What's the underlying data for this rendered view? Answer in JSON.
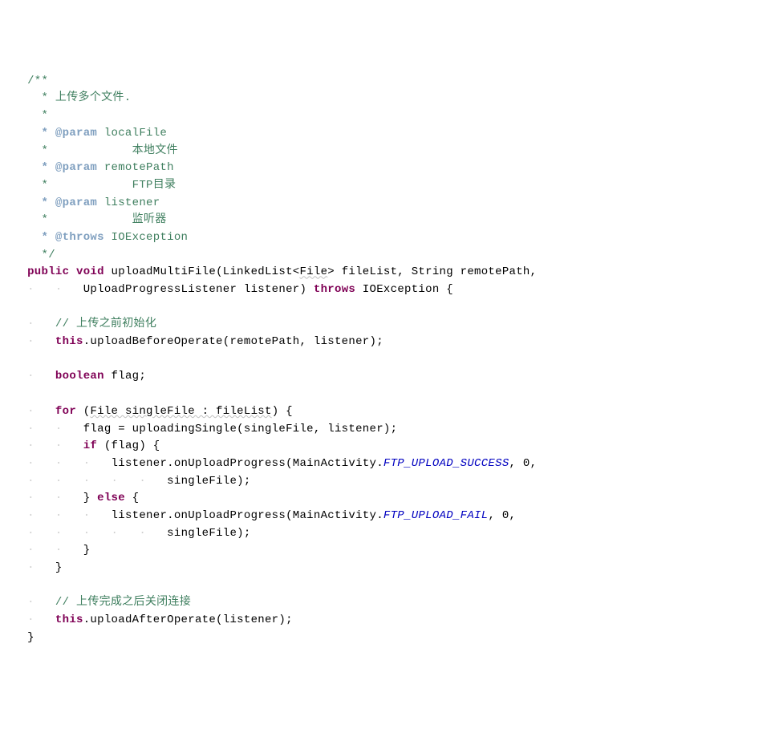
{
  "code": {
    "doc_open": "/**",
    "doc_line1": " * 上传多个文件.",
    "doc_star": " *",
    "doc_param1_tag": " * @param",
    "doc_param1_name": " localFile",
    "doc_param1_desc": " *            本地文件",
    "doc_param2_tag": " * @param",
    "doc_param2_name": " remotePath",
    "doc_param2_desc": " *            FTP目录",
    "doc_param3_tag": " * @param",
    "doc_param3_name": " listener",
    "doc_param3_desc": " *            监听器",
    "doc_throws_tag": " * @throws",
    "doc_throws_name": " IOException",
    "doc_close": " */",
    "kw_public": "public",
    "kw_void": "void",
    "method_name": " uploadMultiFile(LinkedList<",
    "type_file": "File",
    "method_sig_mid": "> fileList, String remotePath,",
    "indent_dot1": "·",
    "indent_sp": "   ",
    "method_sig2": "UploadProgressListener listener) ",
    "kw_throws": "throws",
    "method_sig3": " IOException {",
    "comment1": "// 上传之前初始化",
    "kw_this1": "this",
    "stmt1": ".uploadBeforeOperate(remotePath, listener);",
    "kw_boolean": "boolean",
    "stmt2": " flag;",
    "kw_for": "for",
    "for_open": " (",
    "for_decl": "File singleFile : fileList",
    "for_close": ") {",
    "stmt3": "flag = uploadingSingle(singleFile, listener);",
    "kw_if": "if",
    "stmt4": " (flag) {",
    "stmt5": "listener.onUploadProgress(MainActivity.",
    "field1": "FTP_UPLOAD_SUCCESS",
    "stmt5b": ", 0,",
    "stmt6": "singleFile);",
    "brace_close": "} ",
    "kw_else": "else",
    "stmt7": " {",
    "stmt8": "listener.onUploadProgress(MainActivity.",
    "field2": "FTP_UPLOAD_FAIL",
    "stmt8b": ", 0,",
    "stmt9": "singleFile);",
    "brace_only": "}",
    "comment2": "// 上传完成之后关闭连接",
    "kw_this2": "this",
    "stmt10": ".uploadAfterOperate(listener);",
    "method_close": "}"
  }
}
